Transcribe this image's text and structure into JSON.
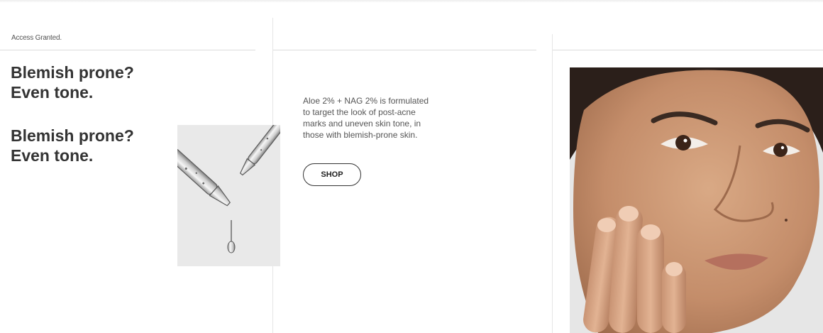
{
  "hero": {
    "eyebrow": "Access Granted.",
    "headlines": [
      {
        "line1": "Blemish prone?",
        "line2": "Even tone."
      },
      {
        "line1": "Blemish prone?",
        "line2": "Even tone."
      }
    ]
  },
  "product": {
    "description": "Aloe 2% + NAG 2% is formulated to target the look of post-acne marks and uneven skin tone, in those with blemish-prone skin.",
    "cta_label": "SHOP"
  },
  "colors": {
    "text": "#333333",
    "muted": "#555555",
    "divider": "#dcdcdc",
    "card_bg": "#e9e9e9"
  }
}
